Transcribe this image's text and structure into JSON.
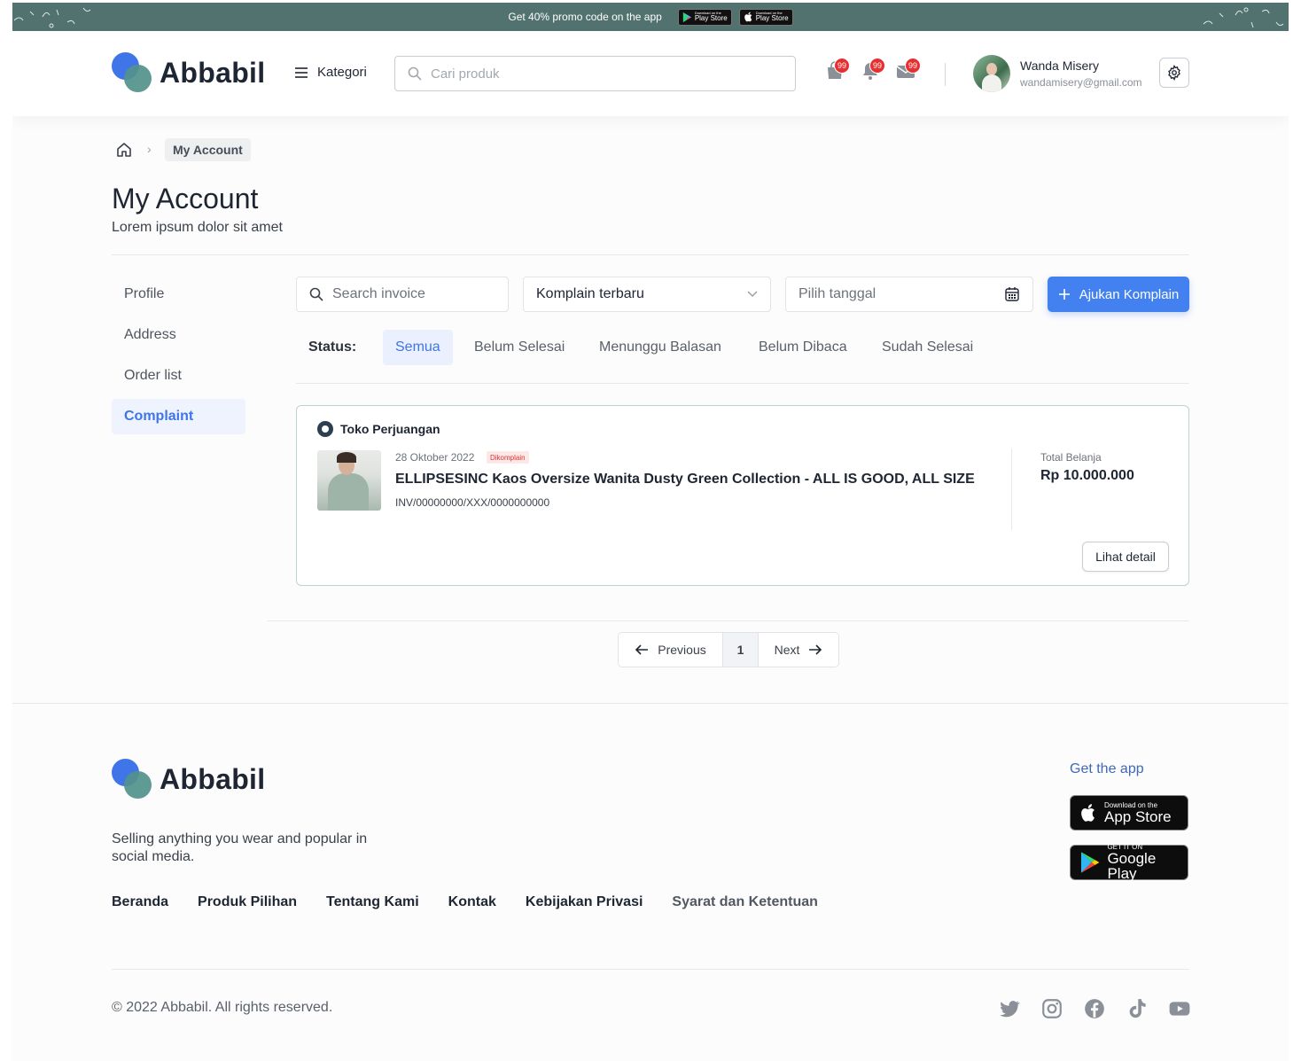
{
  "promo": {
    "text": "Get 40% promo code on the app",
    "badge1": {
      "small": "Download on the",
      "label": "Play Store"
    },
    "badge2": {
      "small": "Download on the",
      "label": "Play Store"
    }
  },
  "header": {
    "brand": "Abbabil",
    "kategori": "Kategori",
    "search_placeholder": "Cari produk",
    "badges": {
      "cart": "99",
      "bell": "99",
      "mail": "99"
    },
    "user_name": "Wanda Misery",
    "user_email": "wandamisery@gmail.com"
  },
  "breadcrumb": {
    "current": "My Account",
    "sep": "›"
  },
  "page": {
    "title": "My Account",
    "subtitle": "Lorem ipsum dolor sit amet"
  },
  "sidebar": {
    "items": [
      {
        "label": "Profile"
      },
      {
        "label": "Address"
      },
      {
        "label": "Order list"
      },
      {
        "label": "Complaint"
      }
    ],
    "active_index": 3
  },
  "filters": {
    "search_placeholder": "Search invoice",
    "sort_value": "Komplain terbaru",
    "date_placeholder": "Pilih tanggal",
    "add_button": "Ajukan Komplain"
  },
  "status": {
    "label": "Status:",
    "tabs": [
      "Semua",
      "Belum Selesai",
      "Menunggu Balasan",
      "Belum Dibaca",
      "Sudah Selesai"
    ],
    "active_index": 0
  },
  "complaint": {
    "shop": "Toko Perjuangan",
    "date": "28 Oktober 2022",
    "badge": "Dikomplain",
    "product": "ELLIPSESINC Kaos Oversize Wanita Dusty Green Collection - ALL IS GOOD, ALL SIZE",
    "invoice": "INV/00000000/XXX/0000000000",
    "total_label": "Total Belanja",
    "total_value": "Rp 10.000.000",
    "detail_button": "Lihat detail"
  },
  "pagination": {
    "prev": "Previous",
    "page": "1",
    "next": "Next"
  },
  "footer": {
    "brand": "Abbabil",
    "tagline": "Selling anything you wear and popular in social media.",
    "links": [
      "Beranda",
      "Produk Pilihan",
      "Tentang Kami",
      "Kontak",
      "Kebijakan Privasi",
      "Syarat dan Ketentuan"
    ],
    "get_app": "Get the app",
    "appstore": {
      "small": "Download on the",
      "label": "App Store"
    },
    "googleplay": {
      "small": "GET IT ON",
      "label": "Google Play"
    },
    "copyright": "© 2022 Abbabil. All rights reserved."
  },
  "colors": {
    "primary": "#4380f0",
    "promo_bar": "#527270",
    "badge_red": "#e5302f"
  }
}
